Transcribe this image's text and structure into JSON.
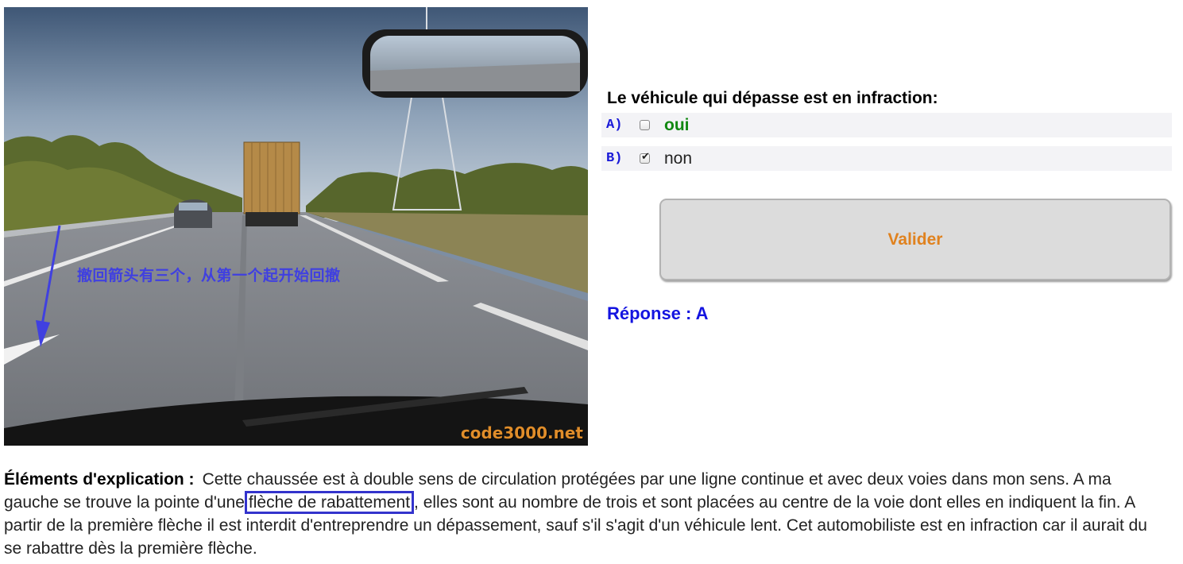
{
  "scene": {
    "annotation": "撤回箭头有三个，从第一个起开始回撤",
    "watermark": "code3000.net",
    "colors": {
      "annotation": "#4040e0",
      "watermark": "#e08d2a"
    }
  },
  "question": {
    "title": "Le véhicule qui dépasse est en infraction:",
    "answers": [
      {
        "letter": "A)",
        "text": "oui",
        "checked": false,
        "is_correct": true
      },
      {
        "letter": "B)",
        "text": "non",
        "checked": true,
        "is_correct": false
      }
    ],
    "validate_label": "Valider",
    "response": "Réponse : A"
  },
  "explanation": {
    "label": "Éléments d'explication :",
    "text_before": "Cette chaussée est à double sens de circulation protégées par une ligne continue et avec deux voies dans mon sens. A ma gauche se trouve la pointe d'une",
    "highlighted": "flèche de rabattement",
    "text_after": ", elles sont au nombre de trois et sont placées au centre de la voie dont elles en indiquent la fin. A partir de la première flèche il est interdit d'entreprendre un dépassement, sauf s'il s'agit d'un véhicule lent. Cet automobiliste est en infraction car il aurait du se rabattre dès la première flèche."
  },
  "colors": {
    "letters": "#1a1ad8",
    "correct_answer": "#118811",
    "validate_text": "#e0821f",
    "response": "#1414e0",
    "highlight_box": "#3333cc"
  }
}
